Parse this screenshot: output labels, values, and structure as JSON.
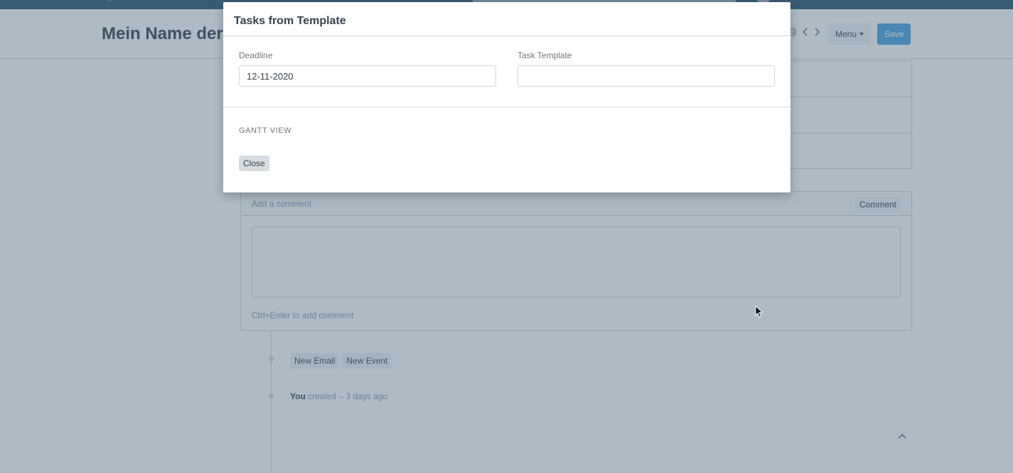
{
  "page": {
    "title": "Mein Name der A",
    "menu_label": "Menu",
    "save_label": "Save"
  },
  "comment": {
    "placeholder_label": "Add a comment",
    "button_label": "Comment",
    "hint": "Ctrl+Enter to add comment"
  },
  "timeline": {
    "new_email": "New Email",
    "new_event": "New Event",
    "created_by": "You",
    "created_text": " created – 3 days ago"
  },
  "modal": {
    "title": "Tasks from Template",
    "deadline_label": "Deadline",
    "deadline_value": "12-11-2020",
    "task_template_label": "Task Template",
    "task_template_value": "",
    "section_label": "GANTT VIEW",
    "close_label": "Close"
  },
  "colors": {
    "navbar": "#2b5570",
    "save_button": "#4aa3df",
    "backdrop": "#4b677d"
  },
  "icons": [
    "logo-icon",
    "print-icon",
    "chevron-left-icon",
    "chevron-right-icon",
    "caret-down-icon",
    "chevron-up-icon",
    "mouse-cursor-icon"
  ]
}
